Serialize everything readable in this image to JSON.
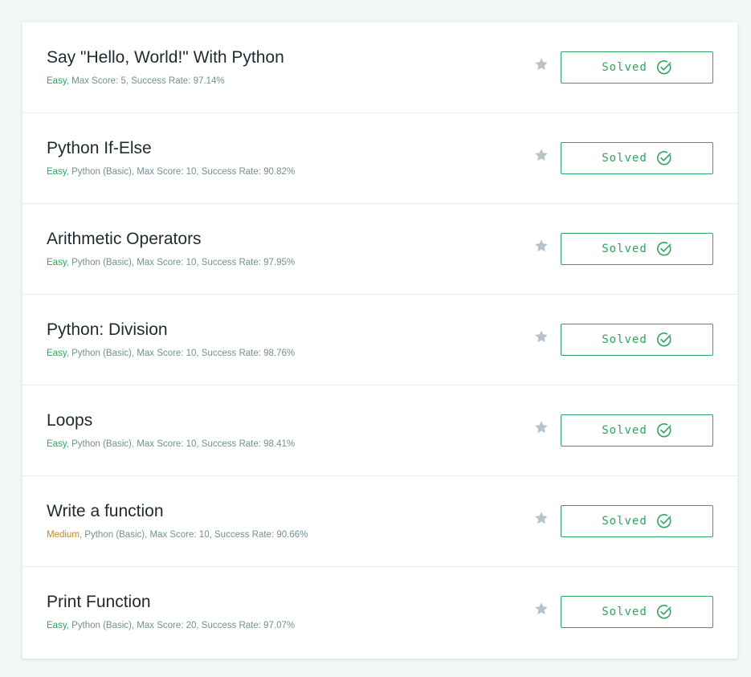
{
  "challenges": [
    {
      "title": "Say \"Hello, World!\" With Python",
      "difficulty": "Easy",
      "difficulty_class": "easy",
      "details": ", Max Score: 5, Success Rate: 97.14%",
      "status": "Solved"
    },
    {
      "title": "Python If-Else",
      "difficulty": "Easy",
      "difficulty_class": "easy",
      "details": ", Python (Basic), Max Score: 10, Success Rate: 90.82%",
      "status": "Solved"
    },
    {
      "title": "Arithmetic Operators",
      "difficulty": "Easy",
      "difficulty_class": "easy",
      "details": ", Python (Basic), Max Score: 10, Success Rate: 97.95%",
      "status": "Solved"
    },
    {
      "title": "Python: Division",
      "difficulty": "Easy",
      "difficulty_class": "easy",
      "details": ", Python (Basic), Max Score: 10, Success Rate: 98.76%",
      "status": "Solved"
    },
    {
      "title": "Loops",
      "difficulty": "Easy",
      "difficulty_class": "easy",
      "details": ", Python (Basic), Max Score: 10, Success Rate: 98.41%",
      "status": "Solved"
    },
    {
      "title": "Write a function",
      "difficulty": "Medium",
      "difficulty_class": "medium",
      "details": ", Python (Basic), Max Score: 10, Success Rate: 90.66%",
      "status": "Solved"
    },
    {
      "title": "Print Function",
      "difficulty": "Easy",
      "difficulty_class": "easy",
      "details": ", Python (Basic), Max Score: 20, Success Rate: 97.07%",
      "status": "Solved"
    }
  ],
  "icons": {
    "bookmark": "star-icon",
    "solved": "check-circle-icon"
  },
  "colors": {
    "easy": "#2ea560",
    "medium": "#c9861a",
    "solved_accent": "#2ea560",
    "star": "#b6c3ca"
  }
}
